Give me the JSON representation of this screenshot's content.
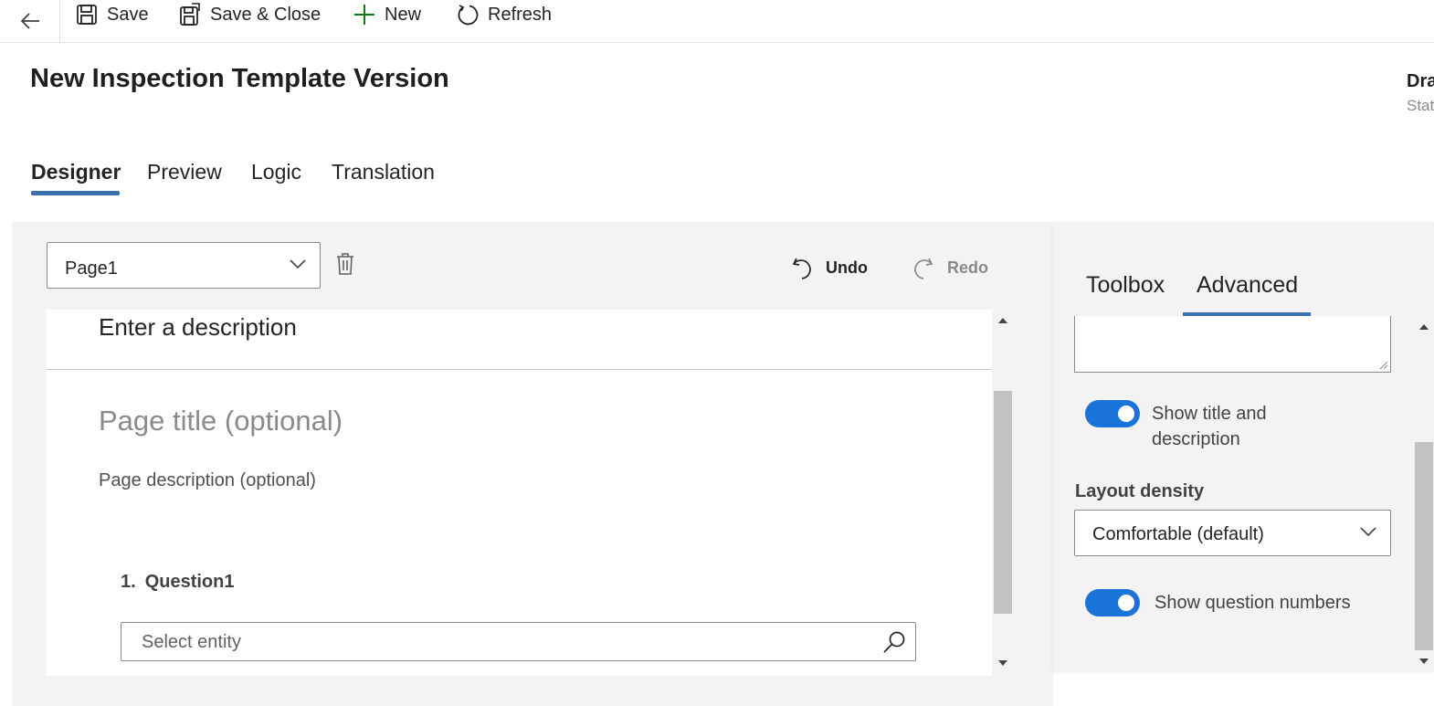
{
  "commandbar": {
    "save": "Save",
    "save_close": "Save & Close",
    "new": "New",
    "refresh": "Refresh"
  },
  "header": {
    "title": "New Inspection Template Version",
    "status_value": "Dra",
    "status_label": "Stat"
  },
  "tabs": [
    "Designer",
    "Preview",
    "Logic",
    "Translation"
  ],
  "designer": {
    "page_select_value": "Page1",
    "undo": "Undo",
    "redo": "Redo",
    "description": "Enter a description",
    "page_title_placeholder": "Page title (optional)",
    "page_description_placeholder": "Page description (optional)",
    "question_number": "1.",
    "question_label": "Question1",
    "entity_placeholder": "Select entity"
  },
  "panel": {
    "tabs": [
      "Toolbox",
      "Advanced"
    ],
    "active_tab": "Advanced",
    "show_title_label_line1": "Show title and",
    "show_title_label_line2": "description",
    "show_title_on": true,
    "layout_density_label": "Layout density",
    "layout_density_value": "Comfortable (default)",
    "show_numbers_label": "Show question numbers",
    "show_numbers_on": true
  },
  "colors": {
    "accent": "#3a6fb0",
    "toggle_on": "#1a73d9",
    "new_icon": "#107c10"
  }
}
